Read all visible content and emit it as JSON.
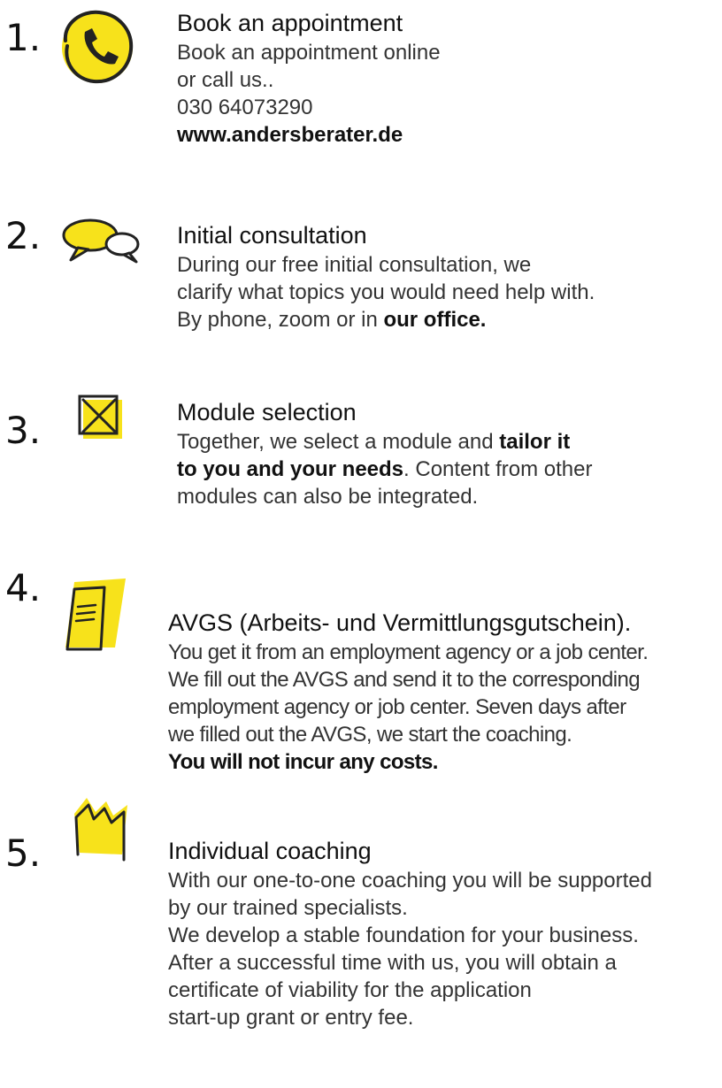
{
  "steps": [
    {
      "number": "1.",
      "icon": "phone-icon",
      "title": "Book an appointment",
      "lines": [
        "Book an appointment online",
        "or call us..",
        "030 64073290"
      ],
      "link": "www.andersberater.de"
    },
    {
      "number": "2.",
      "icon": "speech-bubbles-icon",
      "title": "Initial consultation",
      "lines": [
        "During our free initial consultation, we",
        "clarify what topics you would need help with."
      ],
      "line3_prefix": "By phone, zoom or in ",
      "line3_bold": "our office."
    },
    {
      "number": "3.",
      "icon": "checkbox-icon",
      "title": "Module selection",
      "line1_prefix": "Together, we select a module and ",
      "line1_bold": "tailor it",
      "line2_bold": "to you and your needs",
      "line2_suffix": ". Content from other",
      "line3": "modules can also be integrated."
    },
    {
      "number": "4.",
      "icon": "document-icon",
      "title": "AVGS (Arbeits- und Vermittlungsgutschein).",
      "lines": [
        "You get it from an employment agency or a job center.",
        "We fill out the AVGS and send it to the corresponding",
        "employment agency or job center. Seven days after",
        "we filled out the AVGS, we start the coaching."
      ],
      "bold_line": "You will not incur any costs."
    },
    {
      "number": "5.",
      "icon": "crown-icon",
      "title": "Individual coaching",
      "lines": [
        "With our one-to-one coaching you will be supported",
        "by our trained specialists.",
        "We develop a stable foundation for your business.",
        "After a successful time with us, you will obtain a",
        "certificate of viability for the application",
        "start-up grant or entry fee."
      ]
    }
  ],
  "colors": {
    "accent": "#f7e21b",
    "text": "#333333",
    "heading": "#111111"
  }
}
